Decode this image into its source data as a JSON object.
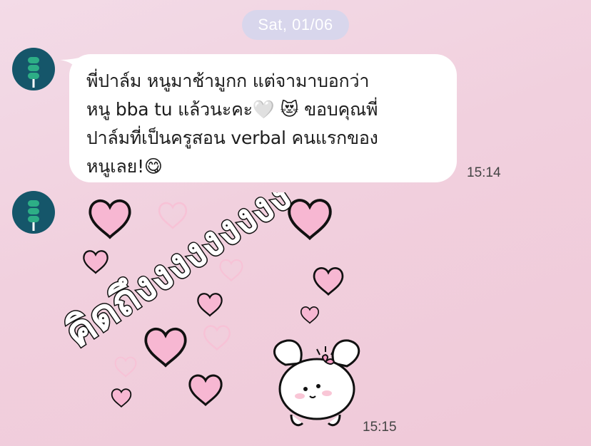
{
  "chat": {
    "date_label": "Sat, 01/06",
    "messages": [
      {
        "type": "text",
        "text": "พี่ปาล์ม หนูมาช้ามูกก แต่จามาบอกว่า\nหนู bba tu แล้วนะคะ🤍 😻 ขอบคุณพี่\nปาล์มที่เป็นครูสอน verbal คนแรกของ\nหนูเลย!😋",
        "time": "15:14"
      },
      {
        "type": "sticker",
        "sticker_text": "คิดถึงงงงงงงงง",
        "time": "15:15"
      }
    ]
  },
  "colors": {
    "background": "#f1d0de",
    "date_pill": "#d8d6ec",
    "avatar": "#15566a",
    "avatar_figure": "#2dae86",
    "heart": "#f7b7d2"
  },
  "icons": {
    "avatar": "green-figure-avatar-icon",
    "sticker": "pink-hearts-bunny-sticker"
  }
}
